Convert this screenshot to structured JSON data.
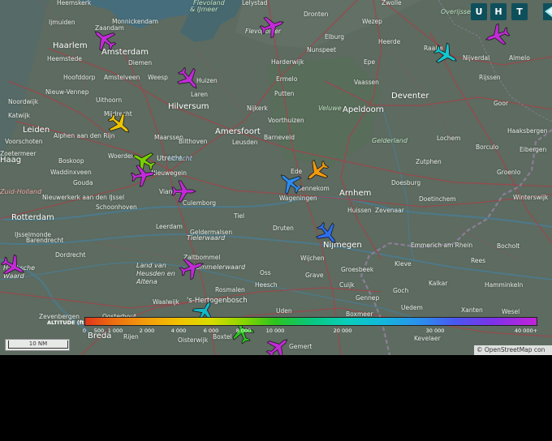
{
  "toolbar": {
    "u_label": "U",
    "h_label": "H",
    "t_label": "T"
  },
  "legend": {
    "title": "ALTITUDE (ft)",
    "ticks": [
      "0",
      "500",
      "1 000",
      "2 000",
      "4 000",
      "6 000",
      "8 000",
      "10 000",
      "20 000",
      "30 000",
      "40 000+"
    ]
  },
  "scale": {
    "label": "10 NM"
  },
  "attribution": "© OpenStreetMap con",
  "colors": {
    "map_bg": "#5d6b60",
    "toolbar": "#0e4f5c",
    "road": "#a0454a",
    "water": "#3f6e86"
  },
  "places": [
    {
      "t": "Heemskerk"
    },
    {
      "t": "Monnickendam"
    },
    {
      "t": "Lelystad"
    },
    {
      "t": "Zwolle"
    },
    {
      "t": "Ijmuiden"
    },
    {
      "t": "Zaandam"
    },
    {
      "t": "Dronten"
    },
    {
      "t": "Wezep"
    },
    {
      "t": "Haarlem"
    },
    {
      "t": "Amsterdam"
    },
    {
      "t": "Flevopolder"
    },
    {
      "t": "Elburg"
    },
    {
      "t": "Heemstede"
    },
    {
      "t": "Diemen"
    },
    {
      "t": "Nunspeet"
    },
    {
      "t": "Epe"
    },
    {
      "t": "Raalte"
    },
    {
      "t": "Nijverdal"
    },
    {
      "t": "Almelo"
    },
    {
      "t": "Hoofddorp"
    },
    {
      "t": "Amstelveen"
    },
    {
      "t": "Weesp"
    },
    {
      "t": "Huizen"
    },
    {
      "t": "Harderwijk"
    },
    {
      "t": "Heerde"
    },
    {
      "t": "Nieuw-Vennep"
    },
    {
      "t": "Laren"
    },
    {
      "t": "Ermelo"
    },
    {
      "t": "Vaassen"
    },
    {
      "t": "Rijssen"
    },
    {
      "t": "Uithoorn"
    },
    {
      "t": "Hilversum"
    },
    {
      "t": "Putten"
    },
    {
      "t": "Deventer"
    },
    {
      "t": "Noordwijk"
    },
    {
      "t": "Nijkerk"
    },
    {
      "t": "Apeldoorn"
    },
    {
      "t": "Goor"
    },
    {
      "t": "Katwijk"
    },
    {
      "t": "Mijdrecht"
    },
    {
      "t": "Voorthuizen"
    },
    {
      "t": "Leiden"
    },
    {
      "t": "Alphen aan den Rijn"
    },
    {
      "t": "Maarssen"
    },
    {
      "t": "Amersfoort"
    },
    {
      "t": "Haaksbergen"
    },
    {
      "t": "Voorschoten"
    },
    {
      "t": "Bilthoven"
    },
    {
      "t": "Leusden"
    },
    {
      "t": "Barneveld"
    },
    {
      "t": "Lochem"
    },
    {
      "t": "Borculo"
    },
    {
      "t": "Eibergen"
    },
    {
      "t": "Zoetermeer"
    },
    {
      "t": "Boskoop"
    },
    {
      "t": "Woerden"
    },
    {
      "t": "Utrecht"
    },
    {
      "t": "Zutphen"
    },
    {
      "t": "Waddinxveen"
    },
    {
      "t": "Nieuwegein"
    },
    {
      "t": "Ede"
    },
    {
      "t": "Doesburg"
    },
    {
      "t": "Groenlo"
    },
    {
      "t": "Gouda"
    },
    {
      "t": "Vianen"
    },
    {
      "t": "Bennekom"
    },
    {
      "t": "Arnhem"
    },
    {
      "t": "Nieuwerkerk aan den IJssel"
    },
    {
      "t": "Schoonhoven"
    },
    {
      "t": "Culemborg"
    },
    {
      "t": "Wageningen"
    },
    {
      "t": "Doetinchem"
    },
    {
      "t": "Winterswijk"
    },
    {
      "t": "Huissen"
    },
    {
      "t": "Zevenaar"
    },
    {
      "t": "Rotterdam"
    },
    {
      "t": "Leerdam"
    },
    {
      "t": "Tiel"
    },
    {
      "t": "Druten"
    },
    {
      "t": "Emmerich am Rhein"
    },
    {
      "t": "Bocholt"
    },
    {
      "t": "Barendrecht"
    },
    {
      "t": "Geldermalsen"
    },
    {
      "t": "Nijmegen"
    },
    {
      "t": "IJsselmonde"
    },
    {
      "t": "Dordrecht"
    },
    {
      "t": "Zaltbommel"
    },
    {
      "t": "Wijchen"
    },
    {
      "t": "Groesbeek"
    },
    {
      "t": "Kleve"
    },
    {
      "t": "Rees"
    },
    {
      "t": "Oss"
    },
    {
      "t": "Grave"
    },
    {
      "t": "Kalkar"
    },
    {
      "t": "Heesch"
    },
    {
      "t": "Rosmalen"
    },
    {
      "t": "Cuijk"
    },
    {
      "t": "Goch"
    },
    {
      "t": "Hamminkeln"
    },
    {
      "t": "Waalwijk"
    },
    {
      "t": "'s-Hertogenbosch"
    },
    {
      "t": "Gennep"
    },
    {
      "t": "Uden"
    },
    {
      "t": "Uedem"
    },
    {
      "t": "Xanten"
    },
    {
      "t": "Wesel"
    },
    {
      "t": "Zevenbergen"
    },
    {
      "t": "Oosterhout"
    },
    {
      "t": "Boxmeer"
    },
    {
      "t": "Breda"
    },
    {
      "t": "Rijen"
    },
    {
      "t": "Oisterwijk"
    },
    {
      "t": "Boxtel"
    },
    {
      "t": "Gemert"
    },
    {
      "t": "Kevelaer"
    }
  ],
  "regions": [
    {
      "t": "Flevoland"
    },
    {
      "t": "& IJmeer"
    },
    {
      "t": "Veluwe"
    },
    {
      "t": "Gelderland"
    },
    {
      "t": "Overijssel"
    },
    {
      "t": "Utrecht"
    },
    {
      "t": "Zuid-Holland"
    },
    {
      "t": "Tielerwaard"
    },
    {
      "t": "Land van Heusden en Altena"
    },
    {
      "t": "Hoeksche Waard"
    },
    {
      "t": "Bommelerwaard"
    },
    {
      "t": "Haag"
    }
  ],
  "aircraft": [
    {
      "name": "Aircraft near Lelystad",
      "alt": "High",
      "color": "#c22ad8",
      "heading": 70
    },
    {
      "name": "Aircraft near Zaandam",
      "alt": "High",
      "color": "#c22ad8",
      "heading": 310
    },
    {
      "name": "Aircraft near Almelo",
      "alt": "High",
      "color": "#c22ad8",
      "heading": 250
    },
    {
      "name": "Aircraft near Raalte",
      "alt": "Mid",
      "color": "#13c6cf",
      "heading": 120
    },
    {
      "name": "Aircraft near Weesp",
      "alt": "High",
      "color": "#c22ad8",
      "heading": 140
    },
    {
      "name": "Aircraft near Mijdrecht",
      "alt": "Low",
      "color": "#efc400",
      "heading": 130
    },
    {
      "name": "Aircraft near Woerden",
      "alt": "Low",
      "color": "#78d000",
      "heading": 300
    },
    {
      "name": "Aircraft near Utrecht",
      "alt": "High",
      "color": "#c22ad8",
      "heading": 80
    },
    {
      "name": "Aircraft near Vianen",
      "alt": "High",
      "color": "#c22ad8",
      "heading": 90
    },
    {
      "name": "Aircraft near Ede",
      "alt": "Low",
      "color": "#f39a0c",
      "heading": 230
    },
    {
      "name": "Aircraft near Bennekom",
      "alt": "Mid",
      "color": "#2d8bef",
      "heading": 310
    },
    {
      "name": "Aircraft near Nijmegen",
      "alt": "Mid",
      "color": "#2d6def",
      "heading": 140
    },
    {
      "name": "Aircraft near Hoeksche Waard",
      "alt": "High",
      "color": "#c22ad8",
      "heading": 120
    },
    {
      "name": "Aircraft near Zaltbommel",
      "alt": "High",
      "color": "#c22ad8",
      "heading": 70
    },
    {
      "name": "Aircraft near 's-Hertogenbosch",
      "alt": "Mid",
      "color": "#13b7c7",
      "heading": 30
    },
    {
      "name": "Aircraft near Boxtel",
      "alt": "Low",
      "color": "#2cc41e",
      "heading": 340
    },
    {
      "name": "Aircraft near Gemert",
      "alt": "High",
      "color": "#c22ad8",
      "heading": 50
    }
  ]
}
